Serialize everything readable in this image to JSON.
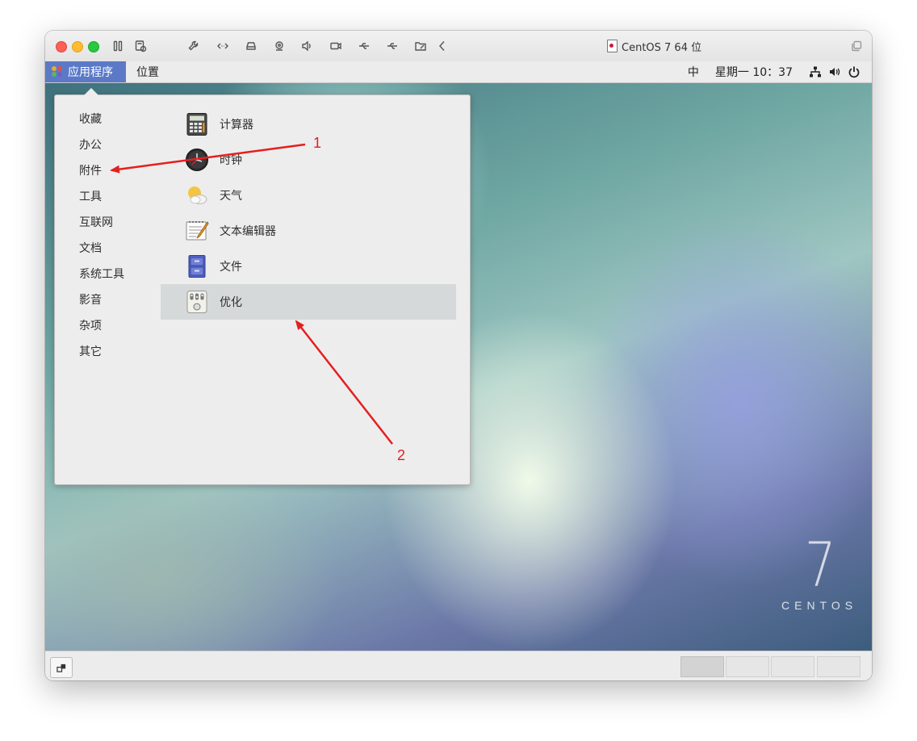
{
  "window": {
    "title": "CentOS 7 64 位",
    "toolbar_icons": [
      "pause-icon",
      "snapshot-icon",
      "settings-wrench-icon",
      "resize-icon",
      "hard-disk-icon",
      "webcam-icon",
      "speaker-icon",
      "camera-icon",
      "usb-icon",
      "usb-icon",
      "shared-folder-icon",
      "back-chevron-icon"
    ]
  },
  "topbar": {
    "apps_label": "应用程序",
    "places_label": "位置",
    "input_method": "中",
    "clock": "星期一 10：37"
  },
  "menu": {
    "categories": [
      "收藏",
      "办公",
      "附件",
      "工具",
      "互联网",
      "文档",
      "系统工具",
      "影音",
      "杂项",
      "其它"
    ],
    "apps": [
      {
        "label": "计算器",
        "icon": "calculator-icon"
      },
      {
        "label": "时钟",
        "icon": "clock-icon"
      },
      {
        "label": "天气",
        "icon": "weather-icon"
      },
      {
        "label": "文本编辑器",
        "icon": "text-editor-icon"
      },
      {
        "label": "文件",
        "icon": "file-cabinet-icon"
      },
      {
        "label": "优化",
        "icon": "tweaks-icon"
      }
    ],
    "selected_app": "优化"
  },
  "desktop": {
    "logo_number": "7",
    "logo_text": "CENTOS"
  },
  "annotations": [
    {
      "label": "1",
      "points_to": "附件"
    },
    {
      "label": "2",
      "points_to": "优化"
    }
  ],
  "colors": {
    "apps_button": "#5b79c7",
    "annotation_red": "#e61e1e",
    "selected_row": "#d6d9d9"
  }
}
